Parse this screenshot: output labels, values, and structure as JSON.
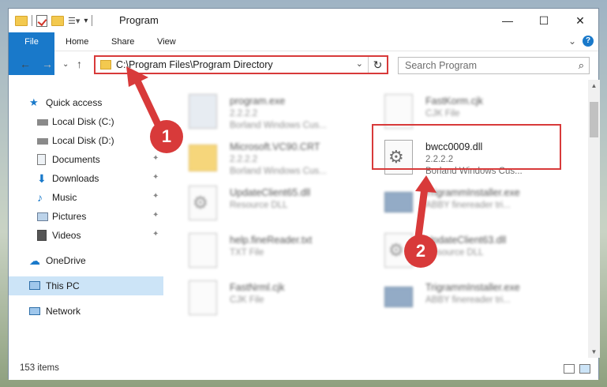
{
  "window": {
    "title": "Program",
    "controls": {
      "minimize": "—",
      "maximize": "☐",
      "close": "✕"
    }
  },
  "ribbon": {
    "tabs": [
      "File",
      "Home",
      "Share",
      "View"
    ],
    "expand": "⌄",
    "help": "?"
  },
  "address": {
    "path": "C:\\Program Files\\Program Directory",
    "dropdown": "⌄",
    "refresh": "↻"
  },
  "nav_buttons": {
    "back": "←",
    "forward": "→",
    "recent": "⌄",
    "up": "↑"
  },
  "search": {
    "placeholder": "Search Program",
    "icon": "⌕"
  },
  "sidebar": {
    "items": [
      {
        "label": "Quick access",
        "icon": "star-icon",
        "pinned": false
      },
      {
        "label": "Local Disk (C:)",
        "icon": "drive-icon",
        "pinned": true
      },
      {
        "label": "Local Disk (D:)",
        "icon": "drive-icon",
        "pinned": true
      },
      {
        "label": "Documents",
        "icon": "documents-icon",
        "pinned": true
      },
      {
        "label": "Downloads",
        "icon": "download-icon",
        "pinned": true
      },
      {
        "label": "Music",
        "icon": "music-icon",
        "pinned": true
      },
      {
        "label": "Pictures",
        "icon": "pictures-icon",
        "pinned": true
      },
      {
        "label": "Videos",
        "icon": "videos-icon",
        "pinned": true
      },
      {
        "label": "OneDrive",
        "icon": "cloud-icon",
        "pinned": false
      },
      {
        "label": "This PC",
        "icon": "computer-icon",
        "pinned": false,
        "selected": true
      },
      {
        "label": "Network",
        "icon": "network-icon",
        "pinned": false
      }
    ],
    "pin_glyph": "📌"
  },
  "files": [
    {
      "name": "program.exe",
      "version": "2.2.2.2",
      "desc": "Borland Windows Cus...",
      "blurred": true
    },
    {
      "name": "FastKorm.cjk",
      "version": "CJK File",
      "desc": "",
      "blurred": true
    },
    {
      "name": "Microsoft.VC90.CRT",
      "version": "2.2.2.2",
      "desc": "Borland Windows Cus...",
      "blurred": true
    },
    {
      "name": "bwcc0009.dll",
      "version": "2.2.2.2",
      "desc": "Borland Windows Cus...",
      "blurred": false
    },
    {
      "name": "UpdateClient65.dll",
      "version": "Resource DLL",
      "desc": "",
      "blurred": true
    },
    {
      "name": "TrigrammInstaller.exe",
      "version": "ABBY finereader tri...",
      "desc": "",
      "blurred": true
    },
    {
      "name": "help.fineReader.txt",
      "version": "TXT File",
      "desc": "",
      "blurred": true
    },
    {
      "name": "UpdateClient63.dll",
      "version": "Resource DLL",
      "desc": "",
      "blurred": true
    },
    {
      "name": "FastNrml.cjk",
      "version": "CJK File",
      "desc": "",
      "blurred": true
    },
    {
      "name": "TrigrammInstaller.exe",
      "version": "ABBY finereader tri...",
      "desc": "",
      "blurred": true
    }
  ],
  "status": {
    "count": "153 items"
  },
  "annotations": {
    "badge1": "1",
    "badge2": "2",
    "accent": "#d83a3a"
  },
  "colors": {
    "file_tab": "#1979ca",
    "selected_nav": "#cce4f7",
    "highlight": "#d83a3a"
  }
}
